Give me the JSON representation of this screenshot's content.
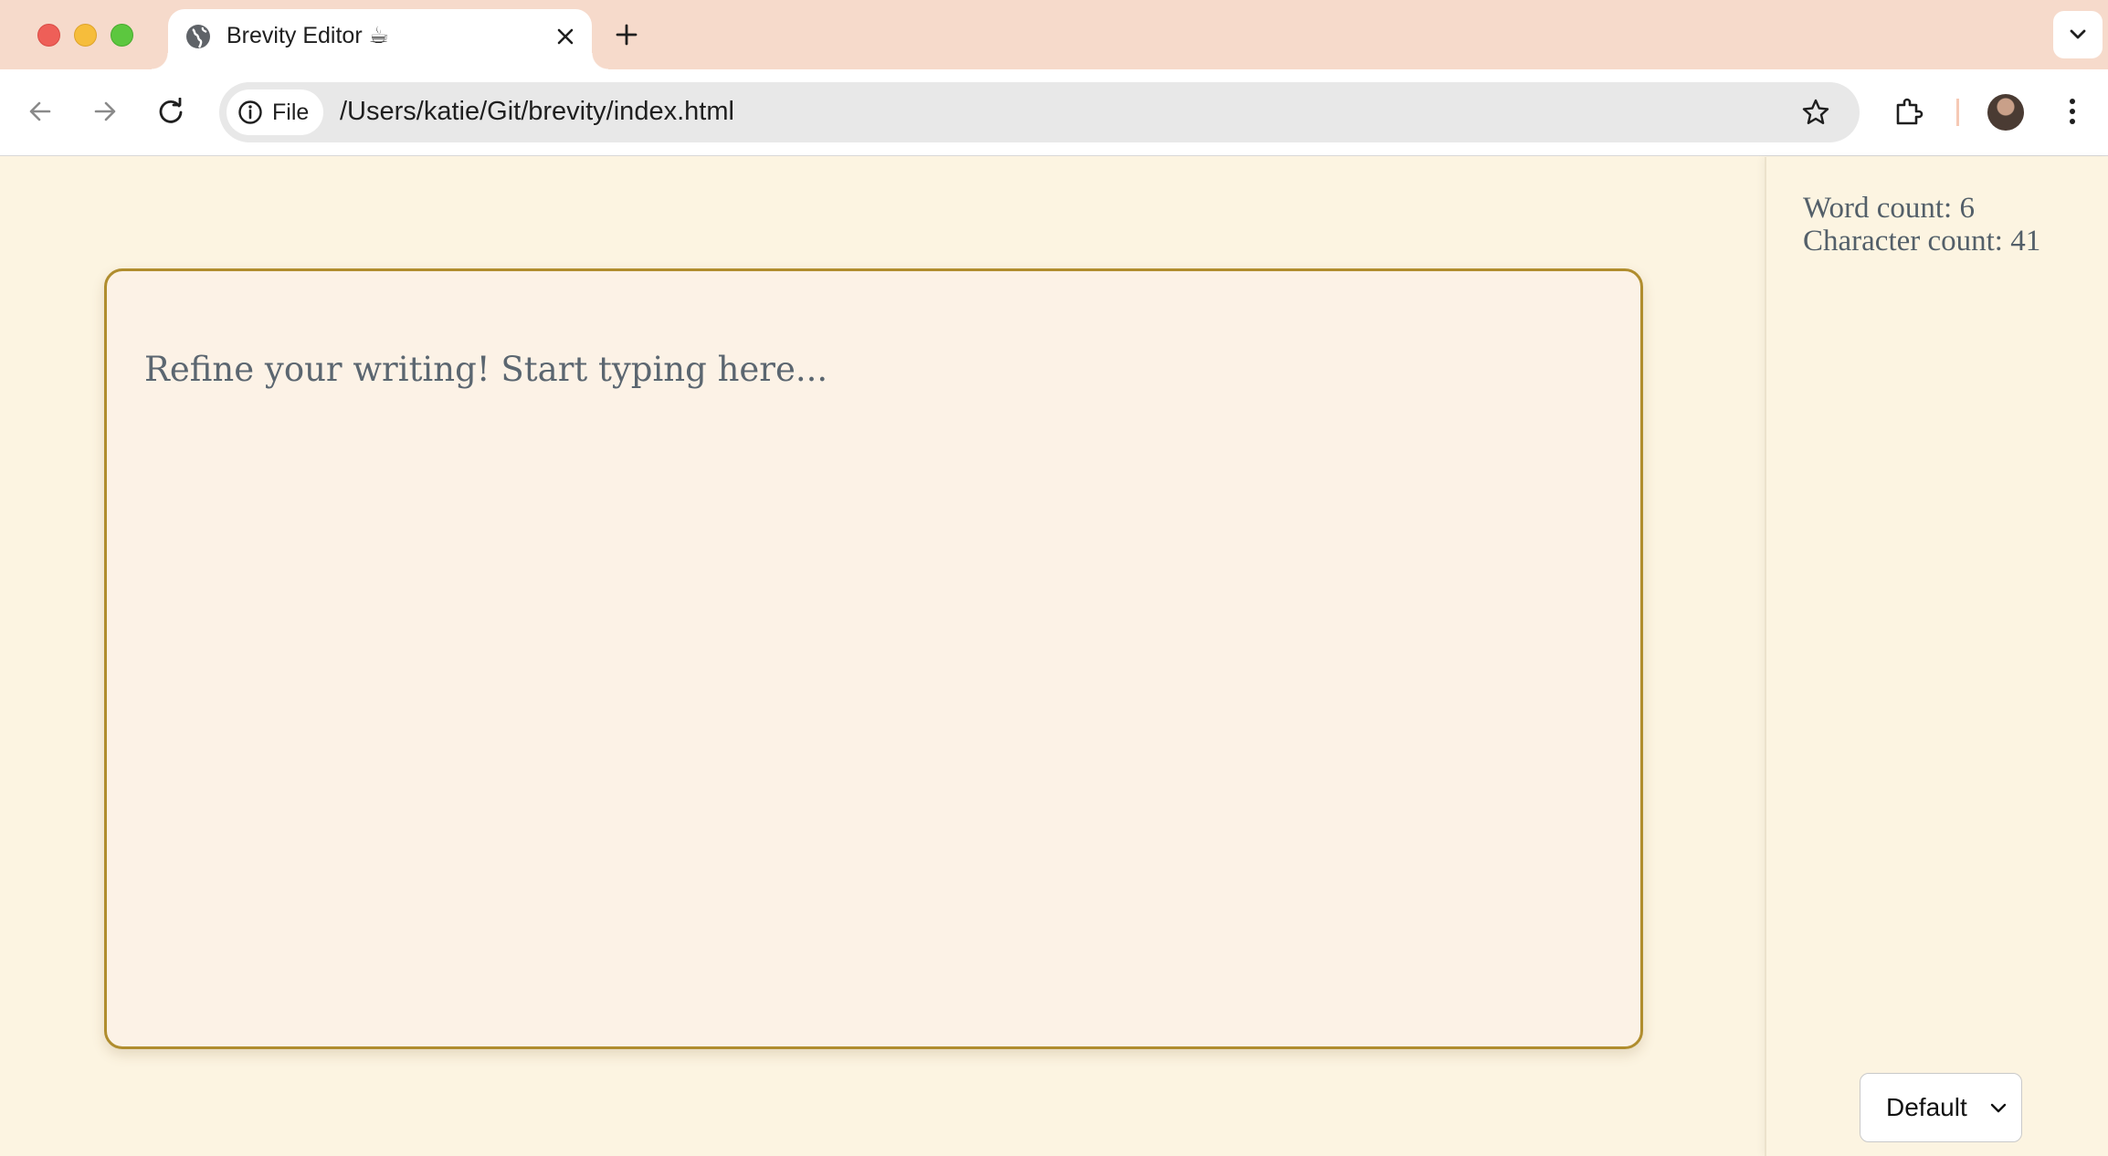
{
  "browser": {
    "tab": {
      "title": "Brevity Editor ☕"
    },
    "address_bar": {
      "chip_label": "File",
      "url": "/Users/katie/Git/brevity/index.html"
    },
    "icons": {
      "back": "arrow-left-icon",
      "forward": "arrow-right-icon",
      "reload": "reload-icon",
      "info": "info-icon",
      "bookmark": "star-icon",
      "extensions": "puzzle-icon",
      "menu": "kebab-menu-icon",
      "new_tab": "plus-icon",
      "tab_close": "close-icon",
      "tab_search": "chevron-down-icon",
      "favicon": "globe-icon"
    },
    "colors": {
      "tabstrip": "#f6dacb",
      "close_dot": "#ee5f58",
      "minimize_dot": "#f6bd3b",
      "maximize_dot": "#5cc73f"
    }
  },
  "app": {
    "editor": {
      "placeholder": "Refine your writing! Start typing here..."
    },
    "stats": {
      "word_count": "Word count: 6",
      "character_count": "Character count: 41"
    },
    "style_select": {
      "selected": "Default"
    },
    "colors": {
      "background": "#fcf4e1",
      "editor_border": "#b08d2e",
      "text": "#5b6670"
    }
  }
}
